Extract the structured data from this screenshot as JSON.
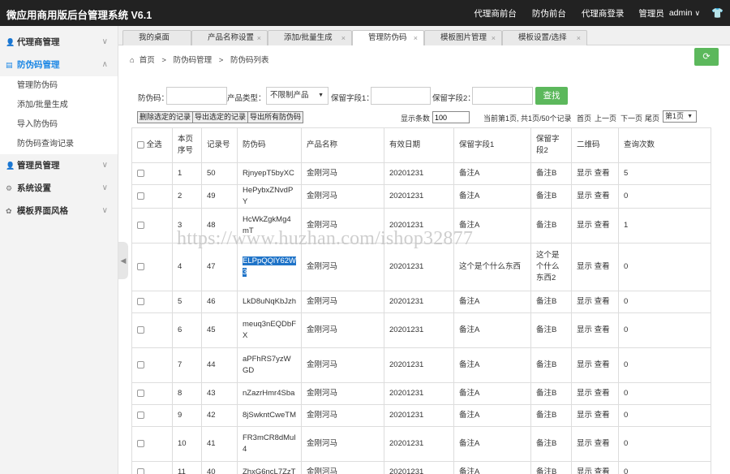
{
  "topbar": {
    "title": "微应用商用版后台管理系统 V6.1",
    "nav": [
      "代理商前台",
      "防伪前台",
      "代理商登录"
    ],
    "user_label": "管理员",
    "user_name": "admin"
  },
  "sidebar": {
    "groups": [
      {
        "label": "代理商管理",
        "icon": "user-icon",
        "active": false
      },
      {
        "label": "防伪码管理",
        "icon": "barcode-icon",
        "active": true
      },
      {
        "label": "管理员管理",
        "icon": "admin-icon",
        "active": false
      },
      {
        "label": "系统设置",
        "icon": "gear-icon",
        "active": false
      },
      {
        "label": "模板界面风格",
        "icon": "palette-icon",
        "active": false
      }
    ],
    "subitems": [
      "管理防伪码",
      "添加/批量生成",
      "导入防伪码",
      "防伪码查询记录"
    ]
  },
  "tabs": [
    "我的桌面",
    "产品名称设置",
    "添加/批量生成",
    "管理防伪码",
    "模板图片管理",
    "模板设置/选择"
  ],
  "breadcrumb": [
    "首页",
    "防伪码管理",
    "防伪码列表"
  ],
  "search": {
    "code_label": "防伪码：",
    "type_label": "产品类型：",
    "type_value": "不限制产品",
    "field1_label": "保留字段1：",
    "field2_label": "保留字段2：",
    "button": "查找"
  },
  "actions": [
    "删除选定的记录",
    "导出选定的记录",
    "导出所有防伪码"
  ],
  "pagination": {
    "size_label": "显示条数",
    "size_value": "100",
    "info": "当前第1页, 共1页/50个记录",
    "links": [
      "首页",
      "上一页",
      "下一页",
      "尾页"
    ],
    "page_select": "第1页"
  },
  "table": {
    "headers": [
      "全选",
      "本页序号",
      "记录号",
      "防伪码",
      "产品名称",
      "有效日期",
      "保留字段1",
      "保留字段2",
      "二维码",
      "查询次数"
    ],
    "rows": [
      {
        "idx": "1",
        "rec": "50",
        "code": "RjnyepT5byXC",
        "name": "金刚河马",
        "date": "20201231",
        "f1": "备注A",
        "f2": "备注B",
        "qr": "显示 查看",
        "count": "5"
      },
      {
        "idx": "2",
        "rec": "49",
        "code": "HePybxZNvdPY",
        "name": "金刚河马",
        "date": "20201231",
        "f1": "备注A",
        "f2": "备注B",
        "qr": "显示 查看",
        "count": "0"
      },
      {
        "idx": "3",
        "rec": "48",
        "code": "HcWkZgkMg4mT",
        "name": "金刚河马",
        "date": "20201231",
        "f1": "备注A",
        "f2": "备注B",
        "qr": "显示 查看",
        "count": "1"
      },
      {
        "idx": "4",
        "rec": "47",
        "code": "ELPpQQlY62W3",
        "name": "金刚河马",
        "date": "20201231",
        "f1": "这个是个什么东西",
        "f2": "这个是个什么东西2",
        "qr": "显示 查看",
        "count": "0"
      },
      {
        "idx": "5",
        "rec": "46",
        "code": "LkD8uNqKbJzh",
        "name": "金刚河马",
        "date": "20201231",
        "f1": "备注A",
        "f2": "备注B",
        "qr": "显示 查看",
        "count": "0"
      },
      {
        "idx": "6",
        "rec": "45",
        "code": "meuq3nEQDbFX",
        "name": "金刚河马",
        "date": "20201231",
        "f1": "备注A",
        "f2": "备注B",
        "qr": "显示 查看",
        "count": "0"
      },
      {
        "idx": "7",
        "rec": "44",
        "code": "aPFhRS7yzWGD",
        "name": "金刚河马",
        "date": "20201231",
        "f1": "备注A",
        "f2": "备注B",
        "qr": "显示 查看",
        "count": "0"
      },
      {
        "idx": "8",
        "rec": "43",
        "code": "nZazrHmr4Sba",
        "name": "金刚河马",
        "date": "20201231",
        "f1": "备注A",
        "f2": "备注B",
        "qr": "显示 查看",
        "count": "0"
      },
      {
        "idx": "9",
        "rec": "42",
        "code": "8jSwkntCweTM",
        "name": "金刚河马",
        "date": "20201231",
        "f1": "备注A",
        "f2": "备注B",
        "qr": "显示 查看",
        "count": "0"
      },
      {
        "idx": "10",
        "rec": "41",
        "code": "FR3mCR8dMul4",
        "name": "金刚河马",
        "date": "20201231",
        "f1": "备注A",
        "f2": "备注B",
        "qr": "显示 查看",
        "count": "0"
      },
      {
        "idx": "11",
        "rec": "40",
        "code": "ZhxG6ncL7ZzT",
        "name": "金刚河马",
        "date": "20201231",
        "f1": "备注A",
        "f2": "备注B",
        "qr": "显示 查看",
        "count": "0"
      }
    ]
  },
  "watermark": "https://www.huzhan.com/ishop32877"
}
